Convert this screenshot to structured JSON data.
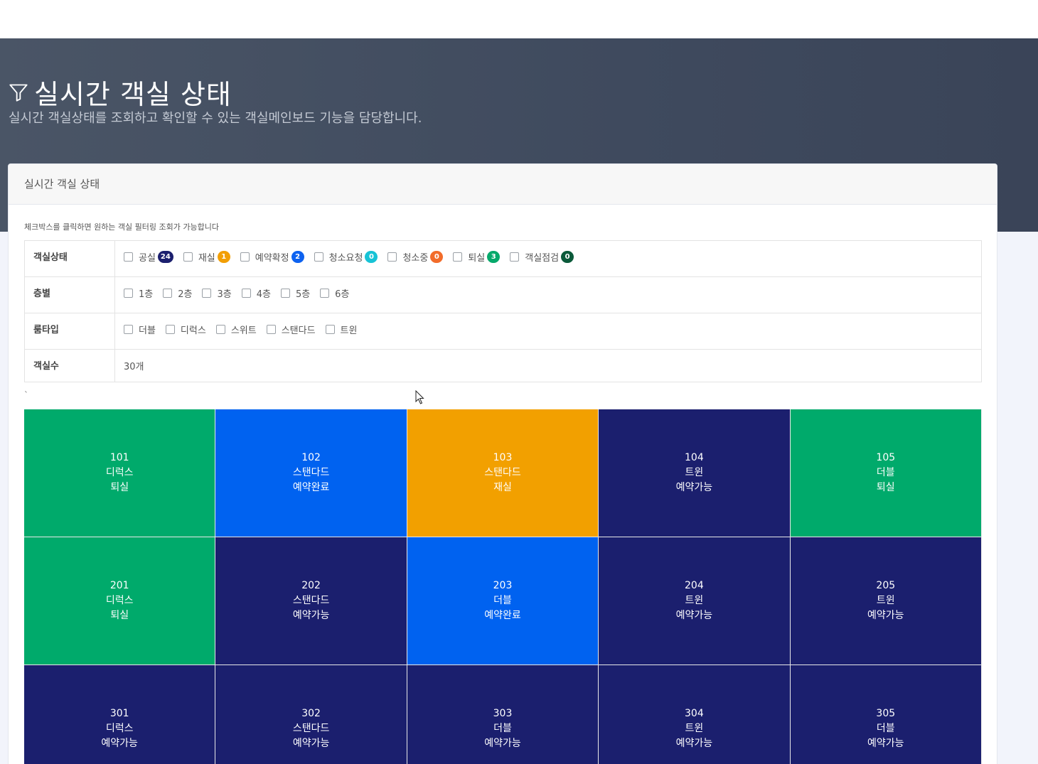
{
  "header": {
    "title": "실시간 객실 상태",
    "subtitle": "실시간 객실상태를 조회하고 확인할 수 있는 객실메인보드 기능을 담당합니다.",
    "icon": "filter-icon"
  },
  "card": {
    "title": "실시간 객실 상태",
    "help_text": "체크박스를 클릭하면 원하는 객실 필터링 조회가 가능합니다",
    "tick_mark": "`"
  },
  "filters": {
    "status": {
      "label": "객실상태",
      "options": [
        {
          "label": "공실",
          "count": "24",
          "color": "#1b1f6e"
        },
        {
          "label": "재실",
          "count": "1",
          "color": "#f29f05"
        },
        {
          "label": "예약확정",
          "count": "2",
          "color": "#0d62f0"
        },
        {
          "label": "청소요청",
          "count": "0",
          "color": "#17c3d6"
        },
        {
          "label": "청소중",
          "count": "0",
          "color": "#f26c2a"
        },
        {
          "label": "퇴실",
          "count": "3",
          "color": "#06a96b"
        },
        {
          "label": "객실점검",
          "count": "0",
          "color": "#0b5a3a"
        }
      ]
    },
    "floor": {
      "label": "층별",
      "options": [
        "1층",
        "2층",
        "3층",
        "4층",
        "5층",
        "6층"
      ]
    },
    "room_type": {
      "label": "룸타입",
      "options": [
        "더블",
        "디럭스",
        "스위트",
        "스탠다드",
        "트윈"
      ]
    },
    "count": {
      "label": "객실수",
      "value": "30개"
    }
  },
  "colors": {
    "퇴실": "#00aa6b",
    "예약완료": "#0062f0",
    "재실": "#f2a000",
    "예약가능": "#1b1f6e"
  },
  "rooms": [
    {
      "no": "101",
      "type": "디럭스",
      "status": "퇴실"
    },
    {
      "no": "102",
      "type": "스탠다드",
      "status": "예약완료"
    },
    {
      "no": "103",
      "type": "스탠다드",
      "status": "재실"
    },
    {
      "no": "104",
      "type": "트윈",
      "status": "예약가능"
    },
    {
      "no": "105",
      "type": "더블",
      "status": "퇴실"
    },
    {
      "no": "201",
      "type": "디럭스",
      "status": "퇴실"
    },
    {
      "no": "202",
      "type": "스탠다드",
      "status": "예약가능"
    },
    {
      "no": "203",
      "type": "더블",
      "status": "예약완료"
    },
    {
      "no": "204",
      "type": "트윈",
      "status": "예약가능"
    },
    {
      "no": "205",
      "type": "트윈",
      "status": "예약가능"
    },
    {
      "no": "301",
      "type": "디럭스",
      "status": "예약가능"
    },
    {
      "no": "302",
      "type": "스탠다드",
      "status": "예약가능"
    },
    {
      "no": "303",
      "type": "더블",
      "status": "예약가능"
    },
    {
      "no": "304",
      "type": "트윈",
      "status": "예약가능"
    },
    {
      "no": "305",
      "type": "더블",
      "status": "예약가능"
    }
  ]
}
